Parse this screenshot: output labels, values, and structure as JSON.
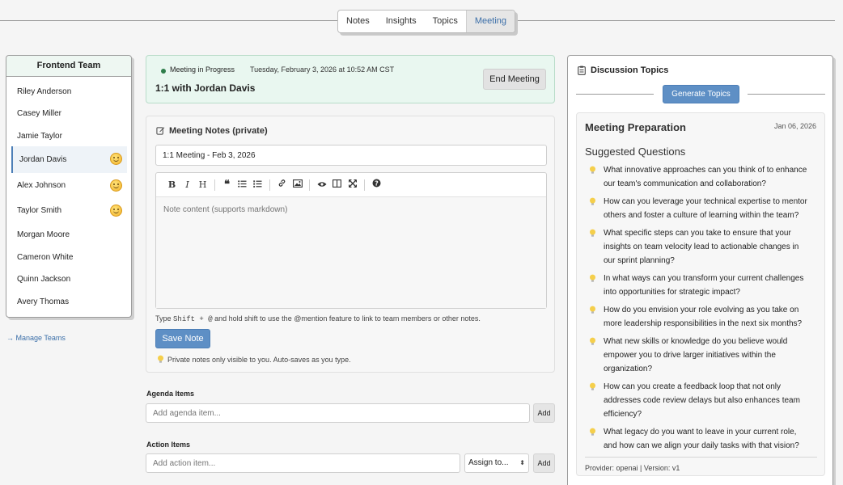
{
  "tabs": {
    "items": [
      "Notes",
      "Insights",
      "Topics",
      "Meeting"
    ],
    "active": "Meeting"
  },
  "team": {
    "title": "Frontend Team",
    "members": [
      {
        "name": "Riley Anderson",
        "emoji": false,
        "active": false
      },
      {
        "name": "Casey Miller",
        "emoji": false,
        "active": false
      },
      {
        "name": "Jamie Taylor",
        "emoji": false,
        "active": false
      },
      {
        "name": "Jordan Davis",
        "emoji": true,
        "active": true
      },
      {
        "name": "Alex Johnson",
        "emoji": true,
        "active": false
      },
      {
        "name": "Taylor Smith",
        "emoji": true,
        "active": false
      },
      {
        "name": "Morgan Moore",
        "emoji": false,
        "active": false
      },
      {
        "name": "Cameron White",
        "emoji": false,
        "active": false
      },
      {
        "name": "Quinn Jackson",
        "emoji": false,
        "active": false
      },
      {
        "name": "Avery Thomas",
        "emoji": false,
        "active": false
      }
    ],
    "manage_label": "→ Manage Teams"
  },
  "meeting": {
    "status": "Meeting in Progress",
    "datetime": "Tuesday, February 3, 2026 at 10:52 AM CST",
    "title": "1:1 with Jordan Davis",
    "end_label": "End Meeting"
  },
  "notes": {
    "title": "Meeting Notes (private)",
    "title_value": "1:1 Meeting - Feb 3, 2026",
    "placeholder": "Note content (supports markdown)",
    "hint_prefix": "Type ",
    "hint_keys": "Shift + @",
    "hint_suffix": " and hold shift to use the @mention feature to link to team members or other notes.",
    "save_label": "Save Note",
    "privacy": "Private notes only visible to you. Auto-saves as you type."
  },
  "agenda": {
    "label": "Agenda Items",
    "placeholder": "Add agenda item...",
    "add_label": "Add"
  },
  "actions": {
    "label": "Action Items",
    "placeholder": "Add action item...",
    "assign_label": "Assign to...",
    "add_label": "Add"
  },
  "discussion": {
    "title": "Discussion Topics",
    "generate_label": "Generate Topics",
    "prep_title": "Meeting Preparation",
    "prep_date": "Jan 06, 2026",
    "suggested_title": "Suggested Questions",
    "questions": [
      [
        "What innovative approaches can you think of to enhance",
        "our team's communication and collaboration?"
      ],
      [
        "How can you leverage your technical expertise to mentor",
        "others and foster a culture of learning within the team?"
      ],
      [
        "What specific steps can you take to ensure that your",
        "insights on team velocity lead to actionable changes in",
        "our sprint planning?"
      ],
      [
        "In what ways can you transform your current challenges",
        "into opportunities for strategic impact?"
      ],
      [
        "How do you envision your role evolving as you take on",
        "more leadership responsibilities in the next six months?"
      ],
      [
        "What new skills or knowledge do you believe would",
        "empower you to drive larger initiatives within the",
        "organization?"
      ],
      [
        "How can you create a feedback loop that not only",
        "addresses code review delays but also enhances team",
        "efficiency?"
      ],
      [
        "What legacy do you want to leave in your current role,",
        "and how can we align your daily tasks with that vision?"
      ]
    ],
    "provider": "Provider: openai | Version: v1"
  }
}
